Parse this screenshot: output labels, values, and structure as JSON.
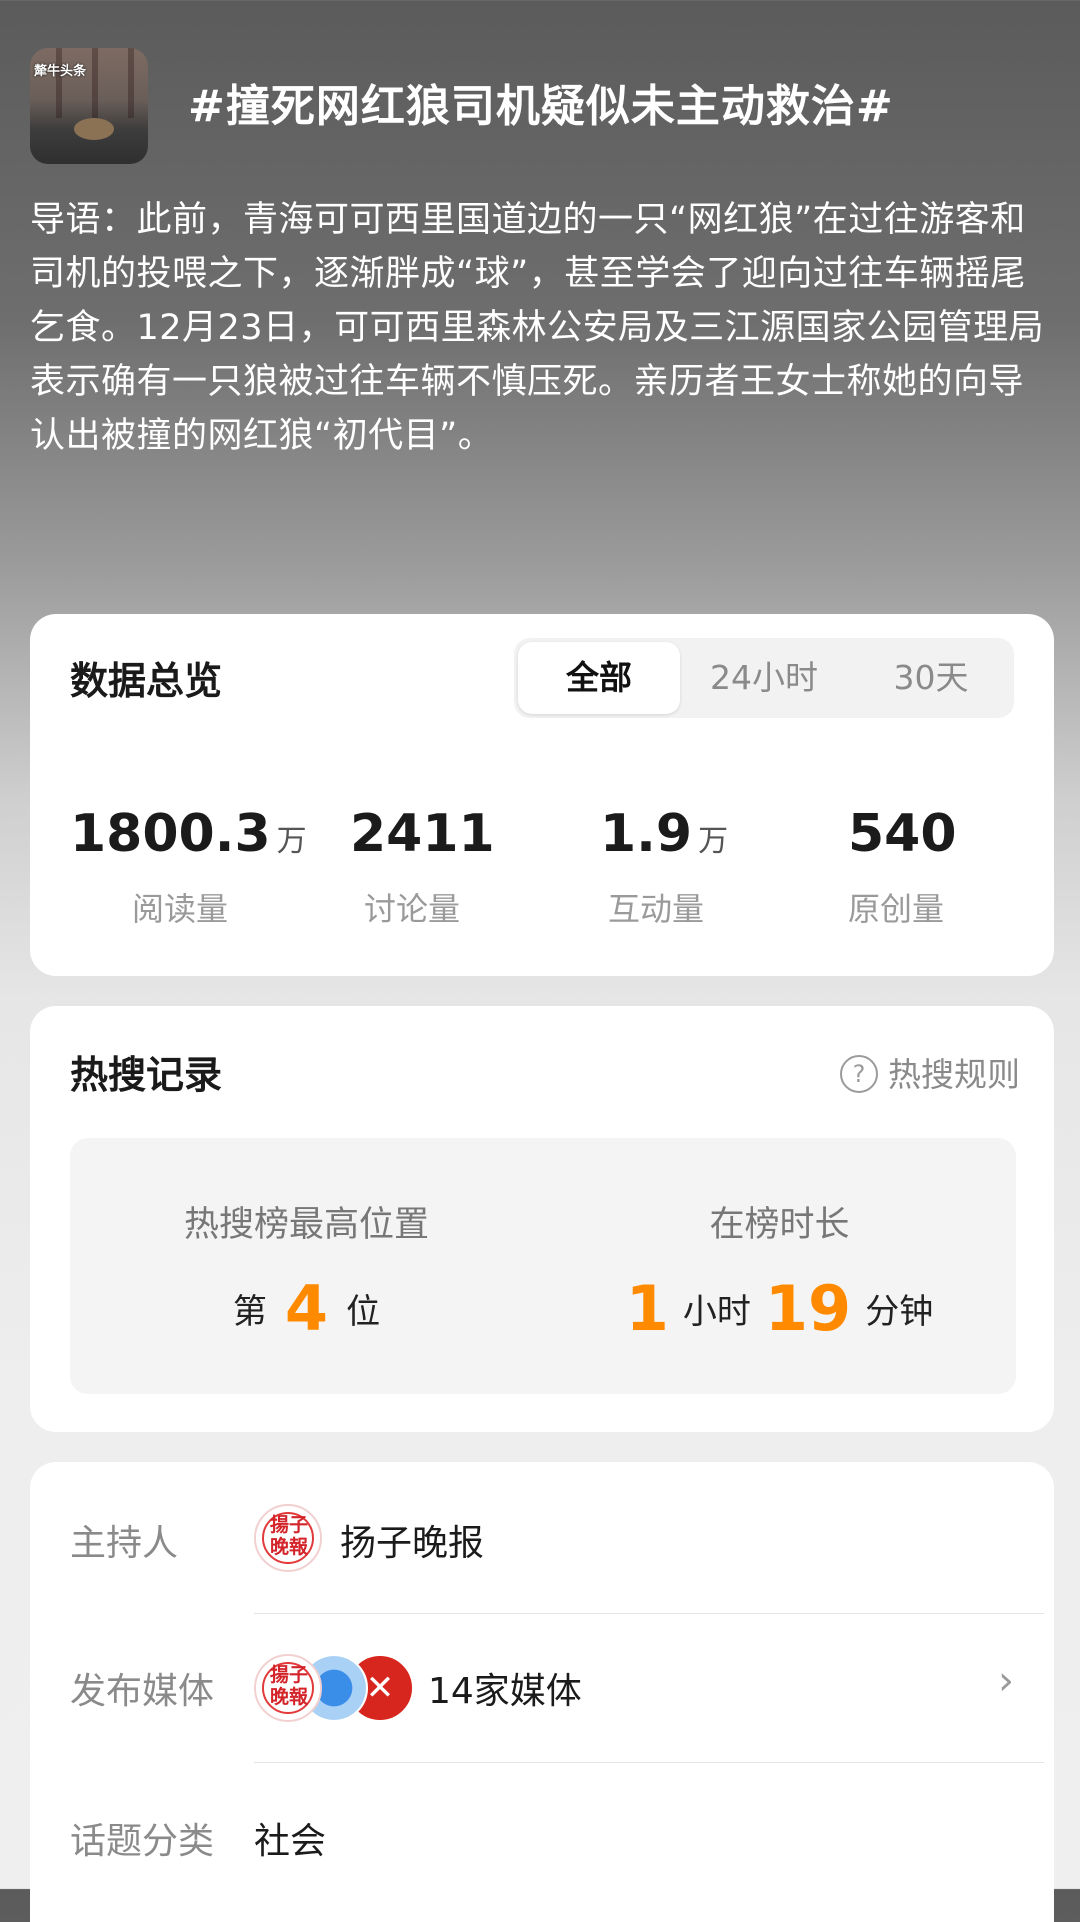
{
  "topic": {
    "title": "#撞死网红狼司机疑似未主动救治#",
    "thumb_caption": "犛牛头条",
    "guide_text": "导语：此前，青海可可西里国道边的一只“网红狼”在过往游客和司机的投喂之下，逐渐胖成“球”，甚至学会了迎向过往车辆摇尾乞食。12月23日，可可西里森林公安局及三江源国家公园管理局表示确有一只狼被过往车辆不慎压死。亲历者王女士称她的向导认出被撞的网红狼“初代目”。"
  },
  "overview": {
    "title": "数据总览",
    "tabs": [
      "全部",
      "24小时",
      "30天"
    ],
    "active_tab": "全部",
    "stats": [
      {
        "value": "1800.3",
        "unit": "万",
        "label": "阅读量"
      },
      {
        "value": "2411",
        "unit": "",
        "label": "讨论量"
      },
      {
        "value": "1.9",
        "unit": "万",
        "label": "互动量"
      },
      {
        "value": "540",
        "unit": "",
        "label": "原创量"
      }
    ]
  },
  "hot": {
    "title": "热搜记录",
    "rule_link": "热搜规则",
    "best_rank": {
      "label": "热搜榜最高位置",
      "prefix": "第",
      "value": "4",
      "suffix": "位"
    },
    "duration": {
      "label": "在榜时长",
      "hours": "1",
      "hours_unit": "小时",
      "minutes": "19",
      "minutes_unit": "分钟"
    }
  },
  "info": {
    "host_label": "主持人",
    "host_name": "扬子晚报",
    "host_logo_text": "揚子晚報",
    "media_label": "发布媒体",
    "media_count": "14家媒体",
    "category_label": "话题分类",
    "category_value": "社会"
  },
  "colors": {
    "accent": "#ff8a00",
    "card": "#ffffff",
    "muted": "#8a8a8a"
  }
}
